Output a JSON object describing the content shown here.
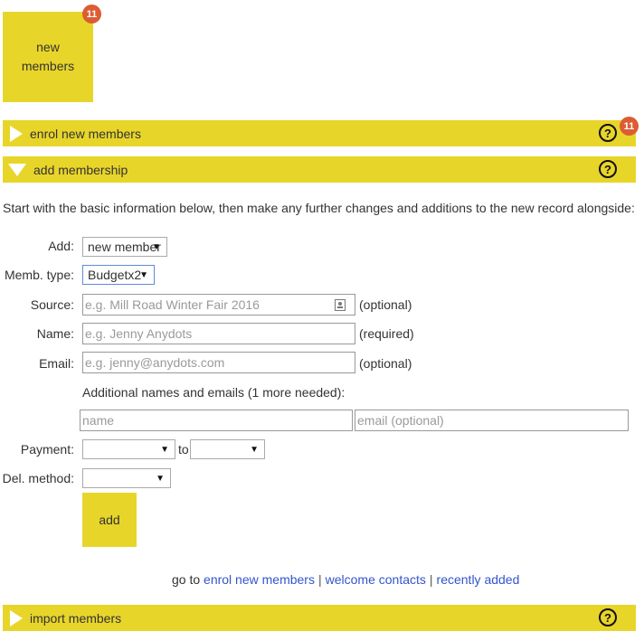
{
  "tile": {
    "line1": "new",
    "line2": "members",
    "badge": "11"
  },
  "sections": {
    "enrol": {
      "label": "enrol new members",
      "badge": "11",
      "help": "?"
    },
    "add_membership": {
      "label": "add membership",
      "help": "?"
    },
    "import": {
      "label": "import members",
      "help": "?"
    }
  },
  "intro": "Start with the basic information below, then make any further changes and additions to the new record alongside:",
  "form": {
    "add_label": "Add:",
    "add_value": "new member",
    "memb_type_label": "Memb. type:",
    "memb_type_value": "Budgetx2",
    "source_label": "Source:",
    "source_placeholder": "e.g. Mill Road Winter Fair 2016",
    "source_note": "(optional)",
    "name_label": "Name:",
    "name_placeholder": "e.g. Jenny Anydots",
    "name_note": "(required)",
    "email_label": "Email:",
    "email_placeholder": "e.g. jenny@anydots.com",
    "email_note": "(optional)",
    "additional_label": "Additional names and emails (1 more needed):",
    "additional_name_placeholder": "name",
    "additional_email_placeholder": "email (optional)",
    "payment_label": "Payment:",
    "payment_to": "to",
    "delivery_label": "Del. method:",
    "add_button": "add"
  },
  "goto": {
    "prefix": "go to",
    "links": [
      "enrol new members",
      "welcome contacts",
      "recently added"
    ],
    "separator": "|"
  },
  "colors": {
    "accent": "#e8d52a",
    "badge": "#dc5c33",
    "link": "#3355cc"
  }
}
